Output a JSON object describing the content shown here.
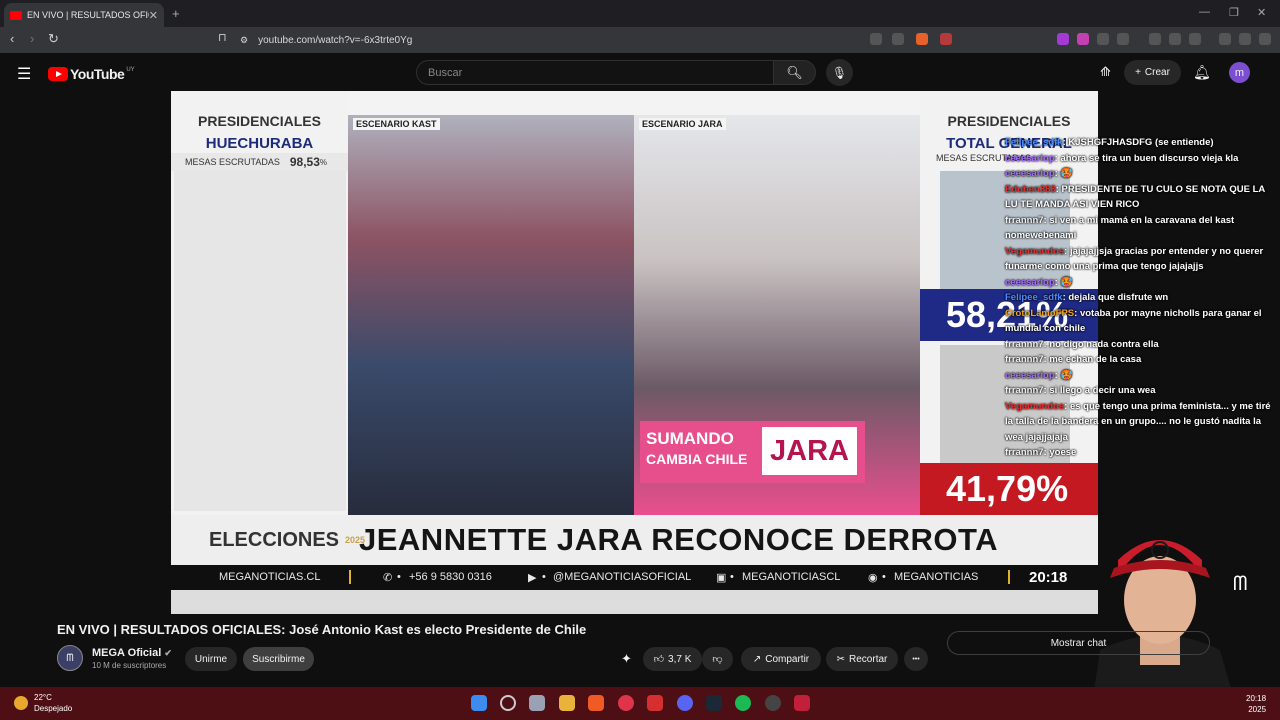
{
  "browser": {
    "tab_title": "EN VIVO | RESULTADOS OFICIALES",
    "new_tab": "+",
    "url": "youtube.com/watch?v=-6x3trte0Yg"
  },
  "youtube": {
    "logo_text": "YouTube",
    "country": "UY",
    "search_placeholder": "Buscar",
    "create_label": "Crear",
    "avatar_letter": "m"
  },
  "video": {
    "left_panel": {
      "title": "PRESIDENCIALES",
      "commune": "HUECHURABA",
      "mesas_label": "MESAS ESCRUTADAS",
      "mesas_value": "98,53",
      "mesas_unit": "%"
    },
    "scenario_kast": "ESCENARIO KAST",
    "scenario_jara": "ESCENARIO JARA",
    "sign_line1": "SUMANDO",
    "sign_line2": "CAMBIA CHILE",
    "sign_name": "JARA",
    "right_panel": {
      "title": "PRESIDENCIALES",
      "subtitle": "TOTAL GENERAL",
      "mesas_label": "MESAS ESCRUTADAS",
      "kast_pct": "58,21%",
      "jara_pct": "41,79%"
    },
    "lower_third": {
      "brand": "ELECCIONES",
      "year": "2025",
      "headline": "JEANNETTE JARA RECONOCE DERROTA"
    },
    "ticker": {
      "site": "MEGANOTICIAS.CL",
      "phone": "+56 9 5830 0316",
      "youtube": "@MEGANOTICIASOFICIAL",
      "twitch": "MEGANOTICIASCL",
      "spotify": "MEGANOTICIAS",
      "time": "20:18"
    }
  },
  "chat": [
    {
      "user": "Felipee_sdfk",
      "color": "#4a8cff",
      "text": "KJSHGFJHASDFG (se entiende)"
    },
    {
      "user": "ceeesariop",
      "color": "#a66cff",
      "text": "ahora se tira un buen discurso vieja kla"
    },
    {
      "user": "ceeesariop",
      "color": "#a66cff",
      "text": "🥵"
    },
    {
      "user": "Eduben383",
      "color": "#e23030",
      "text": "PRESIDENTE DE TU CULO SE NOTA QUE LA LU TE MANDA ASI VIEN RICO"
    },
    {
      "user": "frrannn7",
      "color": "#f1f1f1",
      "text": "si ven a mi mamá en la caravana del kast nomewebenami"
    },
    {
      "user": "Vegamundos",
      "color": "#e23030",
      "text": "jajajajjsja gracias por entender y no querer funarme como una prima que tengo jajajajjs"
    },
    {
      "user": "ceeesariop",
      "color": "#a66cff",
      "text": "🥵"
    },
    {
      "user": "Felipee_sdfk",
      "color": "#4a8cff",
      "text": "dejala que disfrute wn"
    },
    {
      "user": "CrotoLamoFPS",
      "color": "#f0a51c",
      "text": "votaba por mayne nicholls para ganar el mundial con chile"
    },
    {
      "user": "frrannn7",
      "color": "#f1f1f1",
      "text": "no digo nada  contra ella"
    },
    {
      "user": "frrannn7",
      "color": "#f1f1f1",
      "text": "me echan de la casa"
    },
    {
      "user": "ceeesariop",
      "color": "#a66cff",
      "text": "🥵"
    },
    {
      "user": "frrannn7",
      "color": "#f1f1f1",
      "text": "si llego a decir una wea"
    },
    {
      "user": "Vegamundos",
      "color": "#e23030",
      "text": "es que  tengo una prima feminista... y me tiré la talla de la bandera en un grupo.... no le gustó nadita la wea jajajjajaja"
    },
    {
      "user": "frrannn7",
      "color": "#f1f1f1",
      "text": "yoese"
    }
  ],
  "meta": {
    "title": "EN VIVO | RESULTADOS OFICIALES: José Antonio Kast es electo Presidente de Chile",
    "channel": "MEGA Oficial",
    "subs": "10 M de suscriptores",
    "join": "Unirme",
    "subscribe": "Suscribirme",
    "likes": "3,7 K",
    "share": "Compartir",
    "clip": "Recortar",
    "more": "•••",
    "show_chat": "Mostrar chat"
  },
  "taskbar": {
    "temp": "22°C",
    "weather": "Despejado",
    "time": "20:18",
    "year": "2025"
  }
}
